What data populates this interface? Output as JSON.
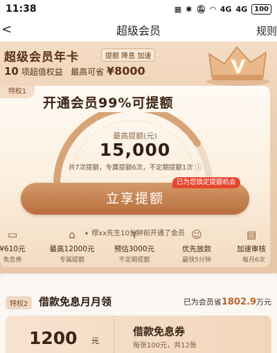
{
  "status_bar": {
    "time": "11:38",
    "icons": [
      "signal-icon",
      "bluetooth-icon",
      "mute-icon",
      "wifi-icon",
      "4g-icon",
      "battery-icon"
    ],
    "network_1": "4G",
    "network_2": "4G",
    "battery": "100"
  },
  "nav": {
    "back_icon": "chevron-left-icon",
    "title": "超级会员",
    "rules_label": "规则"
  },
  "banner": {
    "title": "超级会员年卡",
    "tags": "提额 降息 加速",
    "sub_count": "10",
    "sub_mid": "项超值权益",
    "sub_prefix": "最高可省",
    "sub_amount": "¥8000"
  },
  "privilege1": {
    "badge": "特权1",
    "title": "开通会员99%可提额",
    "gauge_label": "最高提额(元)",
    "gauge_amount": "15,000",
    "gauge_note": "共7次提额，专属提额6次，不定期提额1次",
    "gauge_fill": 0.82,
    "cta_label": "立享提额",
    "cta_tip": "已为您锁定提额机会",
    "activity": "缪xx先生10分钟前开通了会员"
  },
  "privilege_items": [
    {
      "icon": "coupon-icon",
      "title": "¥610元",
      "sub": "免息券"
    },
    {
      "icon": "house-arrow-icon",
      "title": "最高12000元",
      "sub": "专属提额"
    },
    {
      "icon": "money-bag-icon",
      "title": "预估3000元",
      "sub": "不定期提额"
    },
    {
      "icon": "person-icon",
      "title": "优先放款",
      "sub": "最快5分钟"
    },
    {
      "icon": "speed-card-icon",
      "title": "加速审核",
      "sub": "每月6次"
    }
  ],
  "privilege2": {
    "badge": "特权2",
    "title": "借款免息月月领",
    "saved_prefix": "已为会员省",
    "saved_amount": "1802.9",
    "saved_unit": "万元",
    "coupon_amount": "1200",
    "coupon_unit": "元",
    "coupon_name": "借款免息券",
    "coupon_desc": "每张100元，共12张"
  },
  "colors": {
    "accent": "#b96e3e",
    "hero_bg": "#ecd0b4",
    "tip_red": "#e8452f",
    "saved_amount": "#b5652e"
  }
}
